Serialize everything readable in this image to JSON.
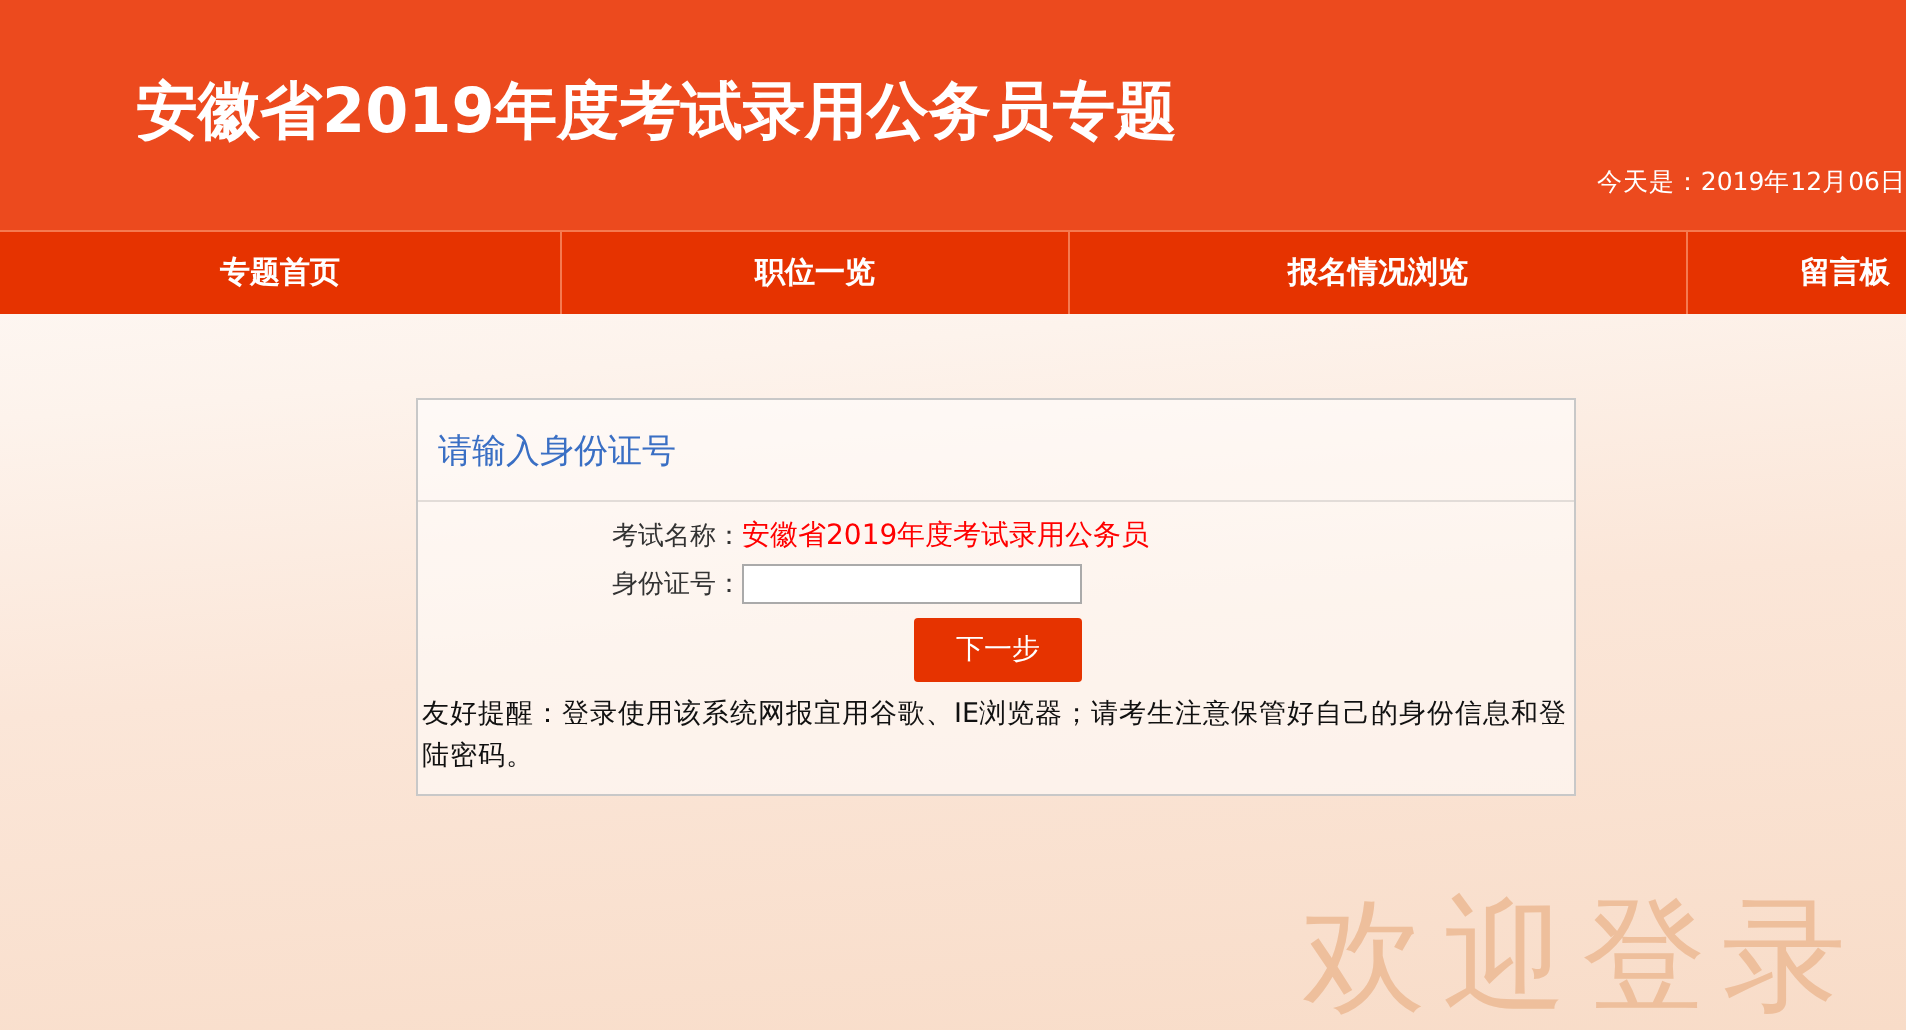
{
  "header": {
    "title": "安徽省2019年度考试录用公务员专题",
    "date": "今天是：2019年12月06日"
  },
  "nav": [
    {
      "label": "专题首页"
    },
    {
      "label": "职位一览"
    },
    {
      "label": "报名情况浏览"
    },
    {
      "label": "留言板"
    }
  ],
  "panel": {
    "title": "请输入身份证号",
    "exam_label": "考试名称：",
    "exam_name": "安徽省2019年度考试录用公务员",
    "id_label": "身份证号：",
    "next_button": "下一步",
    "notice": "友好提醒：登录使用该系统网报宜用谷歌、IE浏览器；请考生注意保管好自己的身份信息和登陆密码。"
  },
  "banner_text": "欢迎登录"
}
